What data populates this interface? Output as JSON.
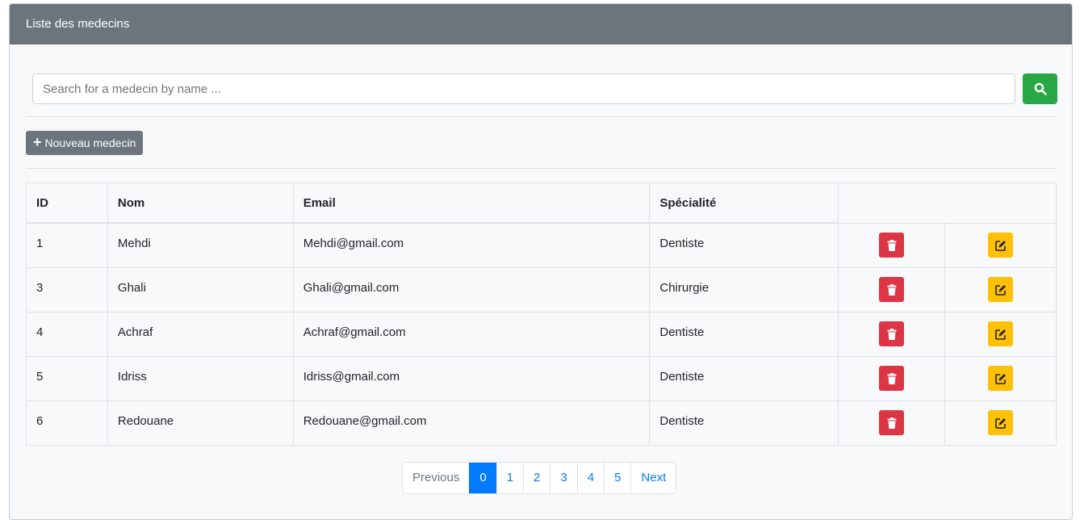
{
  "card": {
    "title": "Liste des medecins"
  },
  "search": {
    "placeholder": "Search for a medecin by name ..."
  },
  "toolbar": {
    "new_label": "Nouveau medecin"
  },
  "table": {
    "headers": {
      "id": "ID",
      "nom": "Nom",
      "email": "Email",
      "specialite": "Spécialité"
    },
    "rows": [
      {
        "id": "1",
        "nom": "Mehdi",
        "email": "Mehdi@gmail.com",
        "specialite": "Dentiste"
      },
      {
        "id": "3",
        "nom": "Ghali",
        "email": "Ghali@gmail.com",
        "specialite": "Chirurgie"
      },
      {
        "id": "4",
        "nom": "Achraf",
        "email": "Achraf@gmail.com",
        "specialite": "Dentiste"
      },
      {
        "id": "5",
        "nom": "Idriss",
        "email": "Idriss@gmail.com",
        "specialite": "Dentiste"
      },
      {
        "id": "6",
        "nom": "Redouane",
        "email": "Redouane@gmail.com",
        "specialite": "Dentiste"
      }
    ]
  },
  "pagination": {
    "previous": "Previous",
    "pages": [
      "0",
      "1",
      "2",
      "3",
      "4",
      "5"
    ],
    "active": "0",
    "next": "Next"
  },
  "icons": {
    "search": "search-icon",
    "add": "plus-icon",
    "delete": "trash-icon",
    "edit": "edit-icon"
  },
  "colors": {
    "header_bg": "#6c757d",
    "search_button": "#28a745",
    "delete_button": "#dc3545",
    "edit_button": "#ffc107",
    "active_page": "#007bff"
  }
}
